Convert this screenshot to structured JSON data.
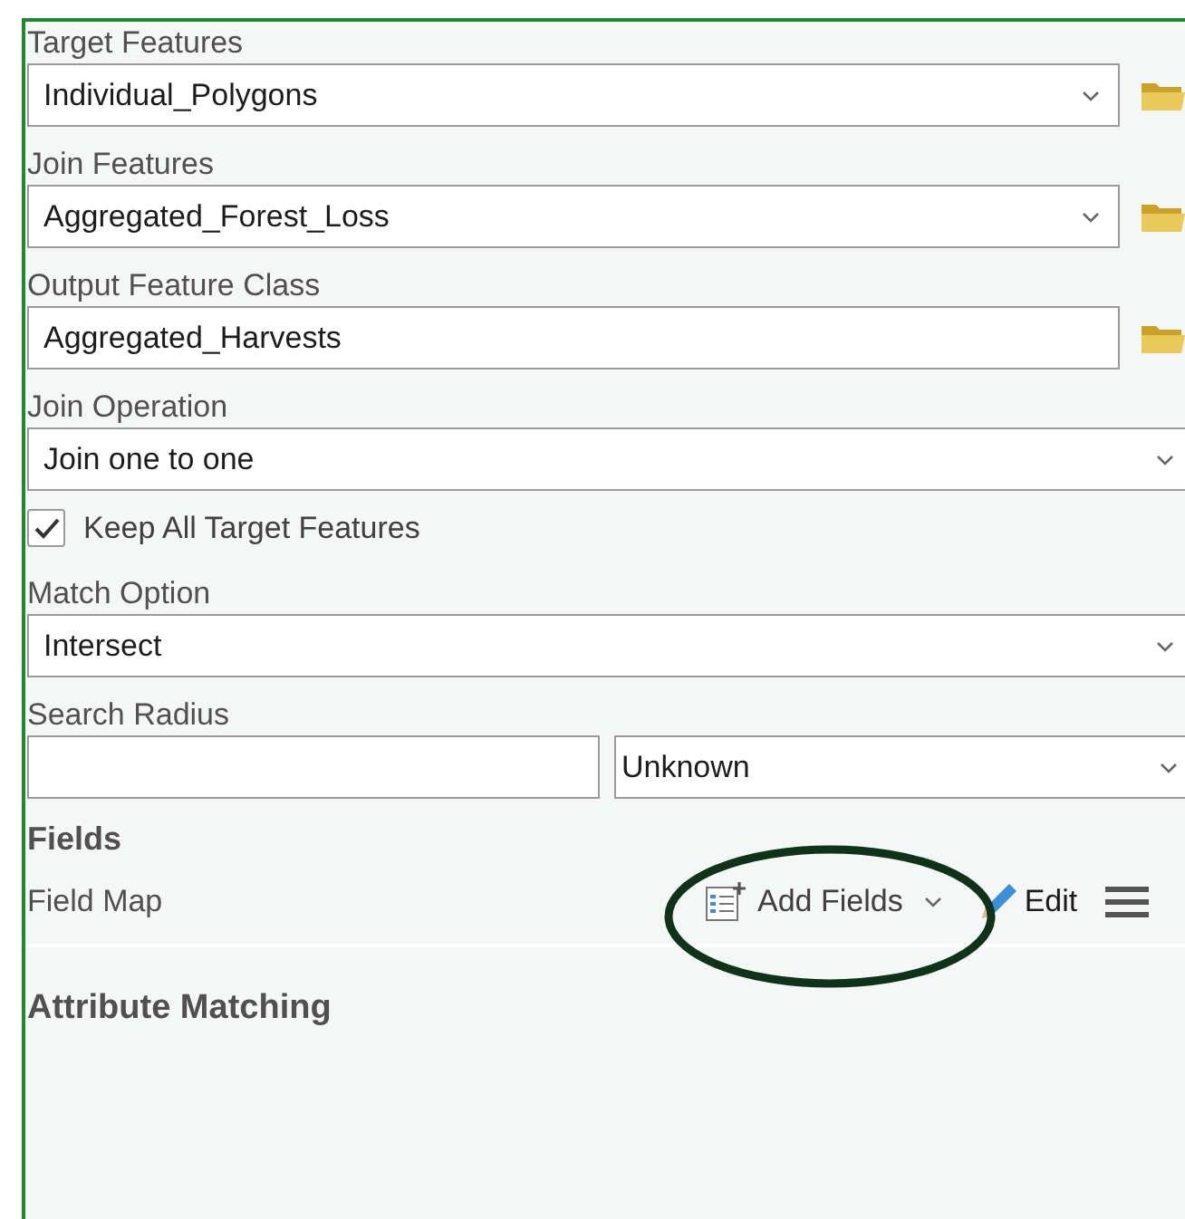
{
  "parameters": [
    {
      "kind": "dropdown",
      "label": "Target Features",
      "value": "Individual_Polygons",
      "browse": true
    },
    {
      "kind": "dropdown",
      "label": "Join Features",
      "value": "Aggregated_Forest_Loss",
      "browse": true
    },
    {
      "kind": "text",
      "label": "Output Feature Class",
      "value": "Aggregated_Harvests",
      "browse": true
    },
    {
      "kind": "dropdown",
      "label": "Join Operation",
      "value": "Join one to one",
      "browse": false
    },
    {
      "kind": "checkbox",
      "label": "Keep All Target Features",
      "checked": true
    },
    {
      "kind": "dropdown",
      "label": "Match Option",
      "value": "Intersect",
      "browse": false
    },
    {
      "kind": "distance",
      "label": "Search Radius",
      "unit": "Unknown"
    }
  ],
  "fields_section": {
    "title": "Fields",
    "field_map_label": "Field Map",
    "add_fields": {
      "label": "Add Fields",
      "circled": true
    },
    "edit": {
      "label": "Edit"
    }
  },
  "attribute_matching": {
    "title": "Attribute Matching"
  }
}
